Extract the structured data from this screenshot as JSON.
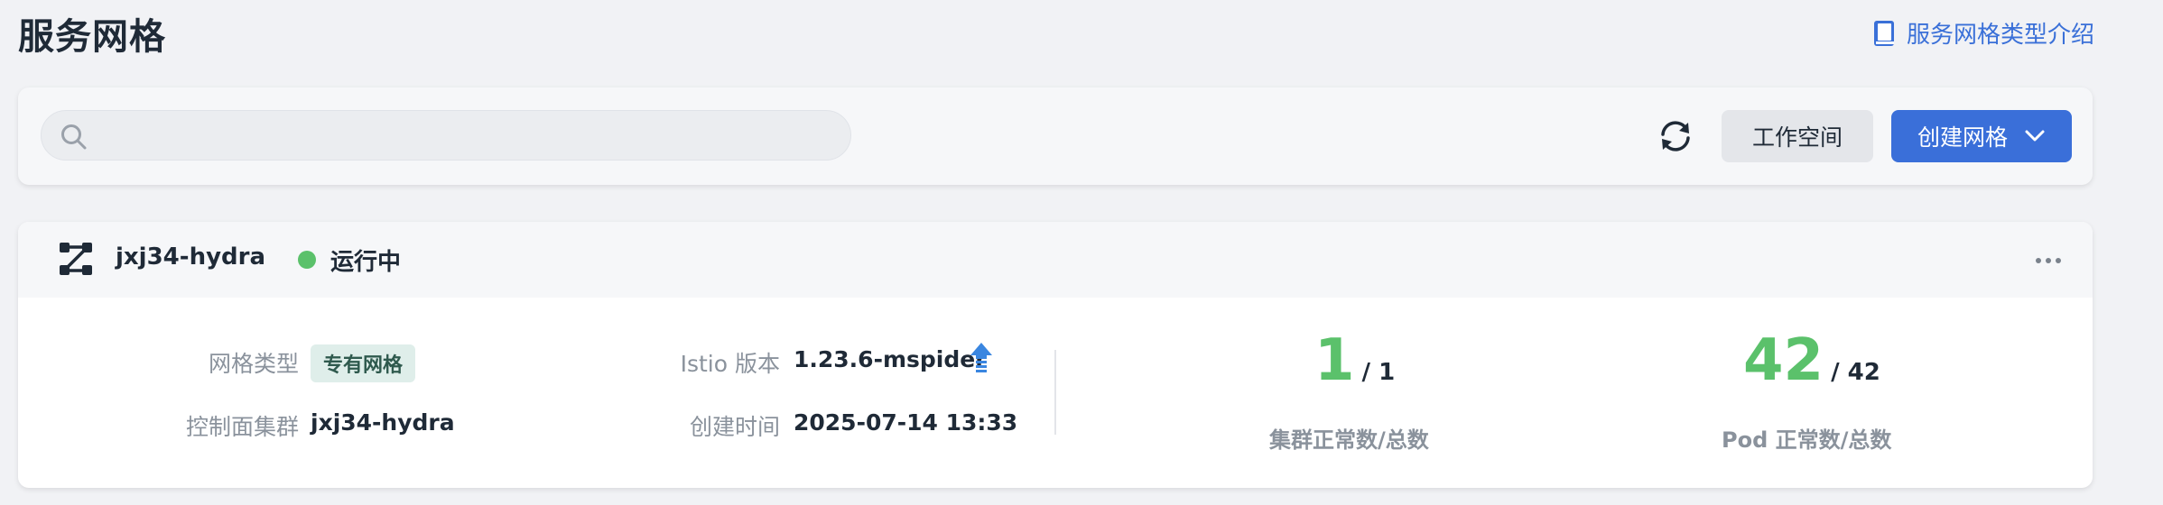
{
  "page": {
    "title": "服务网格"
  },
  "doc_link": {
    "label": "服务网格类型介绍",
    "icon": "book-icon"
  },
  "toolbar": {
    "search_placeholder": "",
    "refresh_icon": "refresh-icon",
    "workspace_label": "工作空间",
    "create_label": "创建网格"
  },
  "mesh": {
    "name": "jxj34-hydra",
    "status": "运行中",
    "status_color": "#5bc16b",
    "mesh_type_label": "网格类型",
    "mesh_type": "专有网格",
    "control_cluster_label": "控制面集群",
    "control_cluster": "jxj34-hydra",
    "istio_label": "Istio 版本",
    "istio_version": "1.23.6-mspider",
    "created_label": "创建时间",
    "created_time": "2025-07-14 13:33",
    "cluster_normal": "1",
    "cluster_total": "/ 1",
    "cluster_stat_label": "集群正常数/总数",
    "pod_normal": "42",
    "pod_total": "/ 42",
    "pod_stat_label": "Pod 正常数/总数"
  },
  "colors": {
    "accent": "#3a6fd9",
    "success": "#5bc16b",
    "link": "#3a70d8"
  }
}
